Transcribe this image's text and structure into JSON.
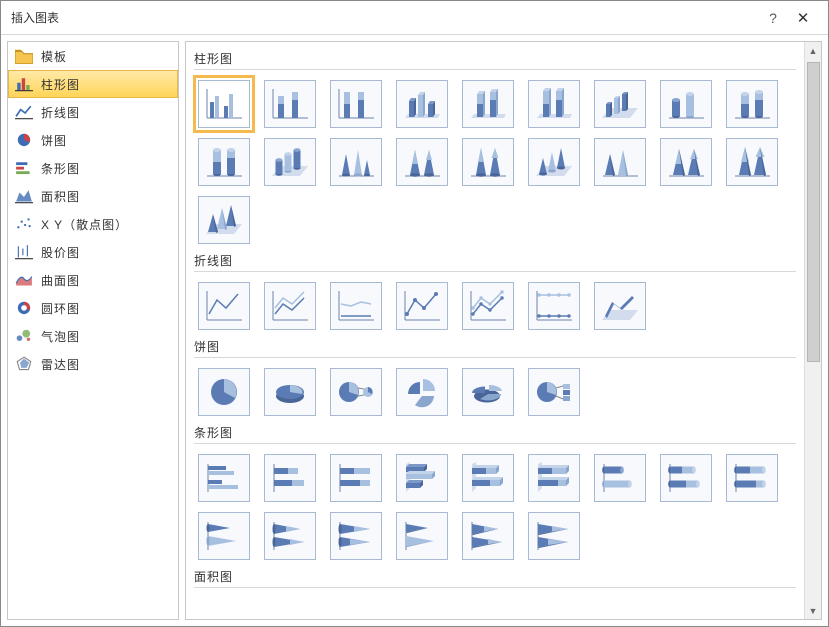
{
  "titlebar": {
    "title": "插入图表",
    "help": "?",
    "close": "✕"
  },
  "sidebar": {
    "items": [
      {
        "id": "templates",
        "label": "模板",
        "icon": "folder-icon"
      },
      {
        "id": "column",
        "label": "柱形图",
        "icon": "column-icon",
        "selected": true
      },
      {
        "id": "line",
        "label": "折线图",
        "icon": "line-icon"
      },
      {
        "id": "pie",
        "label": "饼图",
        "icon": "pie-icon"
      },
      {
        "id": "bar",
        "label": "条形图",
        "icon": "bar-icon"
      },
      {
        "id": "area",
        "label": "面积图",
        "icon": "area-icon"
      },
      {
        "id": "scatter",
        "label": "X Y（散点图）",
        "icon": "scatter-icon"
      },
      {
        "id": "stock",
        "label": "股价图",
        "icon": "stock-icon"
      },
      {
        "id": "surface",
        "label": "曲面图",
        "icon": "surface-icon"
      },
      {
        "id": "doughnut",
        "label": "圆环图",
        "icon": "doughnut-icon"
      },
      {
        "id": "bubble",
        "label": "气泡图",
        "icon": "bubble-icon"
      },
      {
        "id": "radar",
        "label": "雷达图",
        "icon": "radar-icon"
      }
    ]
  },
  "sections": {
    "column": {
      "header": "柱形图"
    },
    "line": {
      "header": "折线图"
    },
    "pie": {
      "header": "饼图"
    },
    "bar": {
      "header": "条形图"
    },
    "area": {
      "header": "面积图"
    }
  },
  "colors": {
    "accent": "#5b7bb4",
    "light": "#a8c0e0",
    "selection": "#f6b94e"
  }
}
